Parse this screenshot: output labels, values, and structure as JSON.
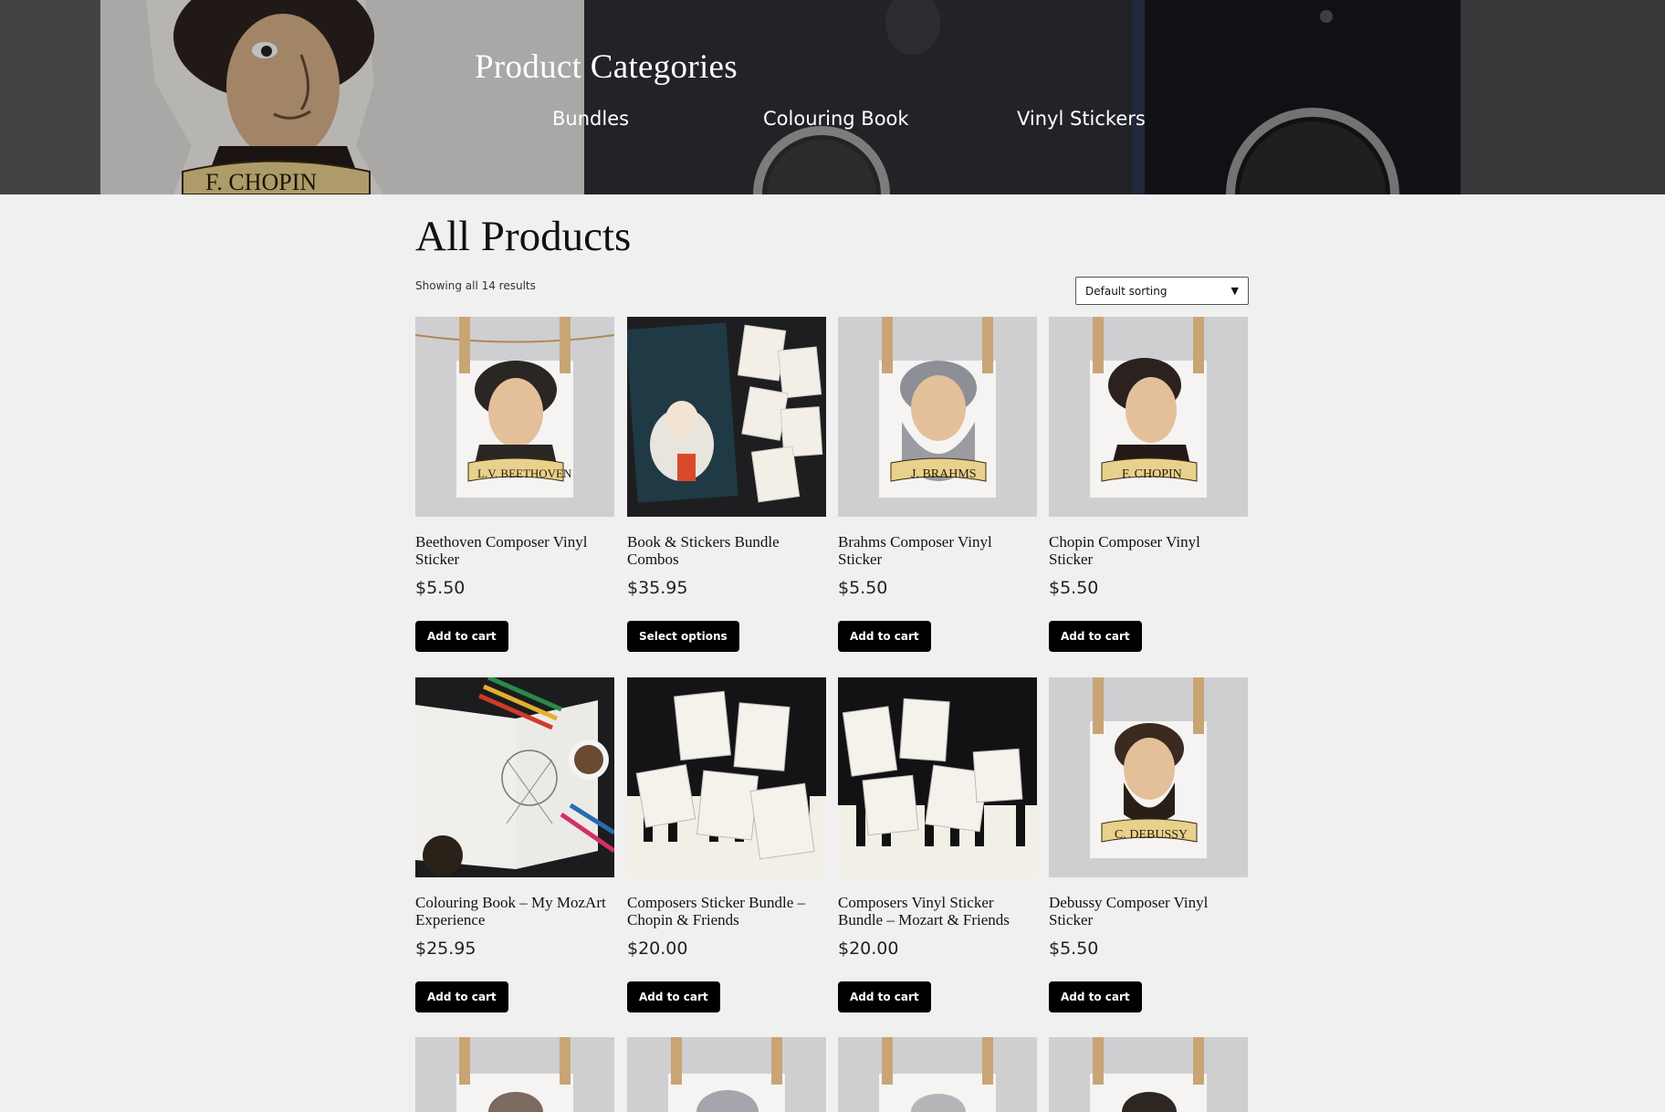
{
  "hero": {
    "title": "Product Categories",
    "categories": [
      {
        "label": "Bundles"
      },
      {
        "label": "Colouring Book"
      },
      {
        "label": "Vinyl Stickers"
      }
    ]
  },
  "main": {
    "title": "All Products",
    "result_count": "Showing all 14 results",
    "sort": {
      "selected": "Default sorting"
    },
    "products": [
      {
        "name": "Beethoven Composer Vinyl Sticker",
        "price": "$5.50",
        "button": "Add to cart",
        "sticker_label": "L.V. BEETHOVEN"
      },
      {
        "name": "Book & Stickers Bundle Combos",
        "price": "$35.95",
        "button": "Select options"
      },
      {
        "name": "Brahms Composer Vinyl Sticker",
        "price": "$5.50",
        "button": "Add to cart",
        "sticker_label": "J. BRAHMS"
      },
      {
        "name": "Chopin Composer Vinyl Sticker",
        "price": "$5.50",
        "button": "Add to cart",
        "sticker_label": "F. CHOPIN"
      },
      {
        "name": "Colouring Book – My MozArt Experience",
        "price": "$25.95",
        "button": "Add to cart"
      },
      {
        "name": "Composers Sticker Bundle – Chopin & Friends",
        "price": "$20.00",
        "button": "Add to cart"
      },
      {
        "name": "Composers Vinyl Sticker Bundle – Mozart & Friends",
        "price": "$20.00",
        "button": "Add to cart"
      },
      {
        "name": "Debussy Composer Vinyl Sticker",
        "price": "$5.50",
        "button": "Add to cart",
        "sticker_label": "C. DEBUSSY"
      }
    ]
  },
  "colors": {
    "background": "#f0f0f0",
    "button": "#000000",
    "hero_text": "#ffffff"
  }
}
